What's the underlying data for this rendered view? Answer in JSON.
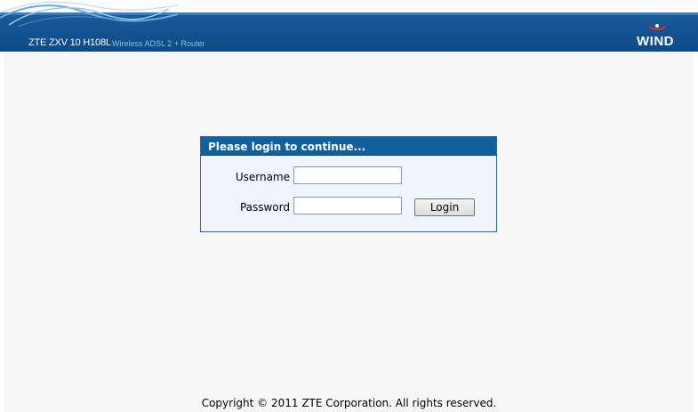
{
  "header": {
    "product_name": "ZTE ZXV 10 H108L",
    "product_desc": "Wireless ADSL 2 + Router",
    "brand": "WIND",
    "band_color": "#11609e"
  },
  "login": {
    "title": "Please login to continue...",
    "username_label": "Username",
    "username_value": "",
    "password_label": "Password",
    "password_value": "",
    "login_button": "Login"
  },
  "footer": {
    "copyright": "Copyright © 2011 ZTE Corporation. All rights reserved."
  }
}
